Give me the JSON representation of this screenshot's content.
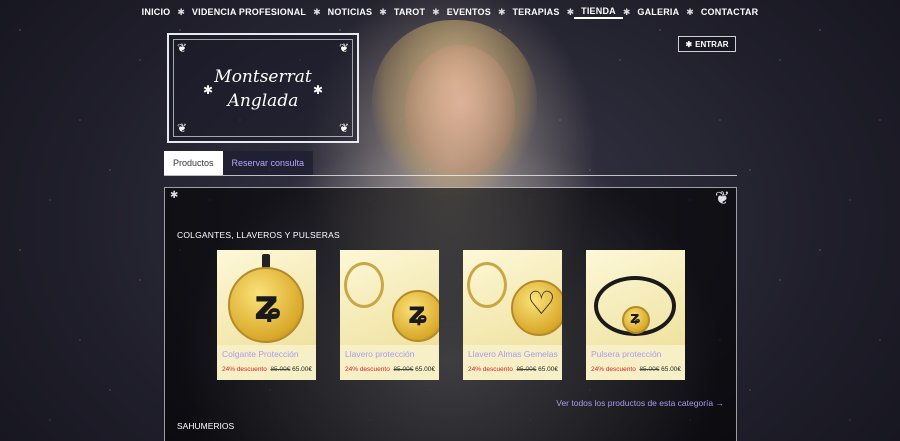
{
  "nav": {
    "items": [
      "INICIO",
      "VIDENCIA PROFESIONAL",
      "NOTICIAS",
      "TAROT",
      "EVENTOS",
      "TERAPIAS",
      "TIENDA",
      "GALERIA",
      "CONTACTAR"
    ],
    "active": "TIENDA",
    "separator": "✱"
  },
  "logo": {
    "line1": "Montserrat",
    "line2": "Anglada"
  },
  "login": {
    "label": "ENTRAR",
    "icon": "star-icon"
  },
  "tabs": [
    {
      "label": "Productos",
      "active": true
    },
    {
      "label": "Reservar consulta",
      "active": false
    }
  ],
  "shop": {
    "category1": "COLGANTES, LLAVEROS Y PULSERAS",
    "products": [
      {
        "name": "Colgante Protección",
        "discount": "24% descuento",
        "old_price": "85.00€",
        "price": "65.00€"
      },
      {
        "name": "Llavero protección",
        "discount": "24% descuento",
        "old_price": "85.00€",
        "price": "65.00€"
      },
      {
        "name": "Llavero Almas Gemelas",
        "discount": "24% descuento",
        "old_price": "85.00€",
        "price": "65.00€"
      },
      {
        "name": "Pulsera protección",
        "discount": "24% descuento",
        "old_price": "85.00€",
        "price": "65.00€"
      }
    ],
    "see_all": "Ver todos los productos de esta categoría →",
    "category2": "SAHUMERIOS"
  },
  "colors": {
    "link": "#a99af0",
    "discount": "#d62020",
    "card_bg": "#f7f0c6"
  }
}
